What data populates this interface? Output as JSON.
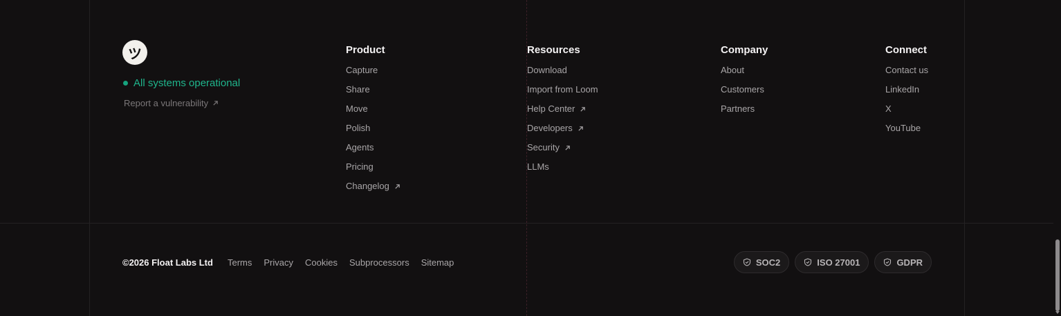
{
  "brand": {
    "logo_glyph": "ツ"
  },
  "status": {
    "label": "All systems operational",
    "color": "#16a37e"
  },
  "vulnerability_link": {
    "label": "Report a vulnerability"
  },
  "columns": [
    {
      "title": "Product",
      "links": [
        {
          "label": "Capture",
          "external": false
        },
        {
          "label": "Share",
          "external": false
        },
        {
          "label": "Move",
          "external": false
        },
        {
          "label": "Polish",
          "external": false
        },
        {
          "label": "Agents",
          "external": false
        },
        {
          "label": "Pricing",
          "external": false
        },
        {
          "label": "Changelog",
          "external": true
        }
      ]
    },
    {
      "title": "Resources",
      "links": [
        {
          "label": "Download",
          "external": false
        },
        {
          "label": "Import from Loom",
          "external": false
        },
        {
          "label": "Help Center",
          "external": true
        },
        {
          "label": "Developers",
          "external": true
        },
        {
          "label": "Security",
          "external": true
        },
        {
          "label": "LLMs",
          "external": false
        }
      ]
    },
    {
      "title": "Company",
      "links": [
        {
          "label": "About",
          "external": false
        },
        {
          "label": "Customers",
          "external": false
        },
        {
          "label": "Partners",
          "external": false
        }
      ]
    },
    {
      "title": "Connect",
      "links": [
        {
          "label": "Contact us",
          "external": false
        },
        {
          "label": "LinkedIn",
          "external": false
        },
        {
          "label": "X",
          "external": false
        },
        {
          "label": "YouTube",
          "external": false
        }
      ]
    }
  ],
  "bottom": {
    "copyright": "©2026 Float Labs Ltd",
    "legal_links": [
      "Terms",
      "Privacy",
      "Cookies",
      "Subprocessors",
      "Sitemap"
    ],
    "badges": [
      "SOC2",
      "ISO 27001",
      "GDPR"
    ]
  },
  "icons": {
    "external_link": "arrow-up-right-icon",
    "badge": "shield-check-icon"
  }
}
